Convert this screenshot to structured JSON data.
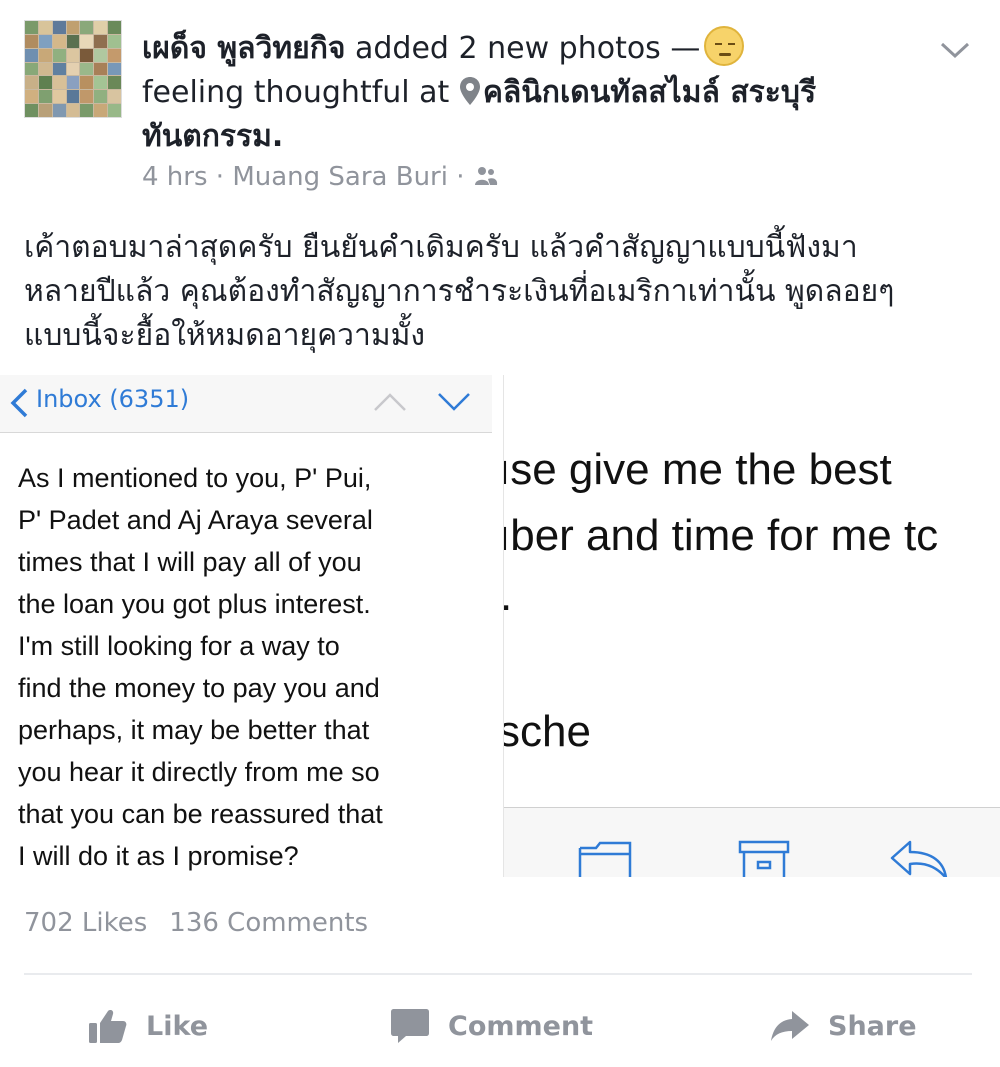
{
  "post": {
    "author": "เผด็จ พูลวิทยกิจ",
    "action_text": "added 2 new photos —",
    "feeling_text": "feeling thoughtful at",
    "location_line1": "คลินิกเดนทัลสไมล์ สระบุรี",
    "location_line2": "ทันตกรรม.",
    "time": "4 hrs",
    "separator": "·",
    "place": "Muang Sara Buri",
    "body": [
      "เค้าตอบมาล่าสุดครับ ยืนยันคำเดิมครับ แล้วคำสัญญาแบบนี้ฟังมา",
      "หลายปีแล้ว คุณต้องทำสัญญาการชำระเงินที่อเมริกาเท่านั้น พูดลอยๆ",
      "แบบนี้จะยื้อให้หมดอายุความมั้ง"
    ],
    "icons": {
      "emoji": "thoughtful-emoji-icon",
      "location": "location-pin-icon",
      "audience": "friends-icon",
      "menu": "chevron-down-icon"
    }
  },
  "photo_left": {
    "inbox_label": "Inbox (6351)",
    "mail_lines": [
      "As I mentioned to you, P' Pui,",
      "P' Padet and Aj Araya several",
      "times that I will pay all of you",
      "the loan you got plus interest.",
      "I'm still looking for a way to",
      "find the money to pay you and",
      "perhaps, it may be better that",
      "you hear it directly from me so",
      "that you can be reassured that",
      "I will do it as I promise?"
    ]
  },
  "photo_right": {
    "lines": [
      "ıse give me the best",
      "ıber and time for me tc",
      ".",
      "sche"
    ]
  },
  "stats": {
    "likes": "702 Likes",
    "comments": "136 Comments"
  },
  "actions": {
    "like": "Like",
    "comment": "Comment",
    "share": "Share"
  },
  "colors": {
    "text": "#1d2129",
    "muted": "#90949c",
    "ios_blue": "#2f7bd6"
  }
}
